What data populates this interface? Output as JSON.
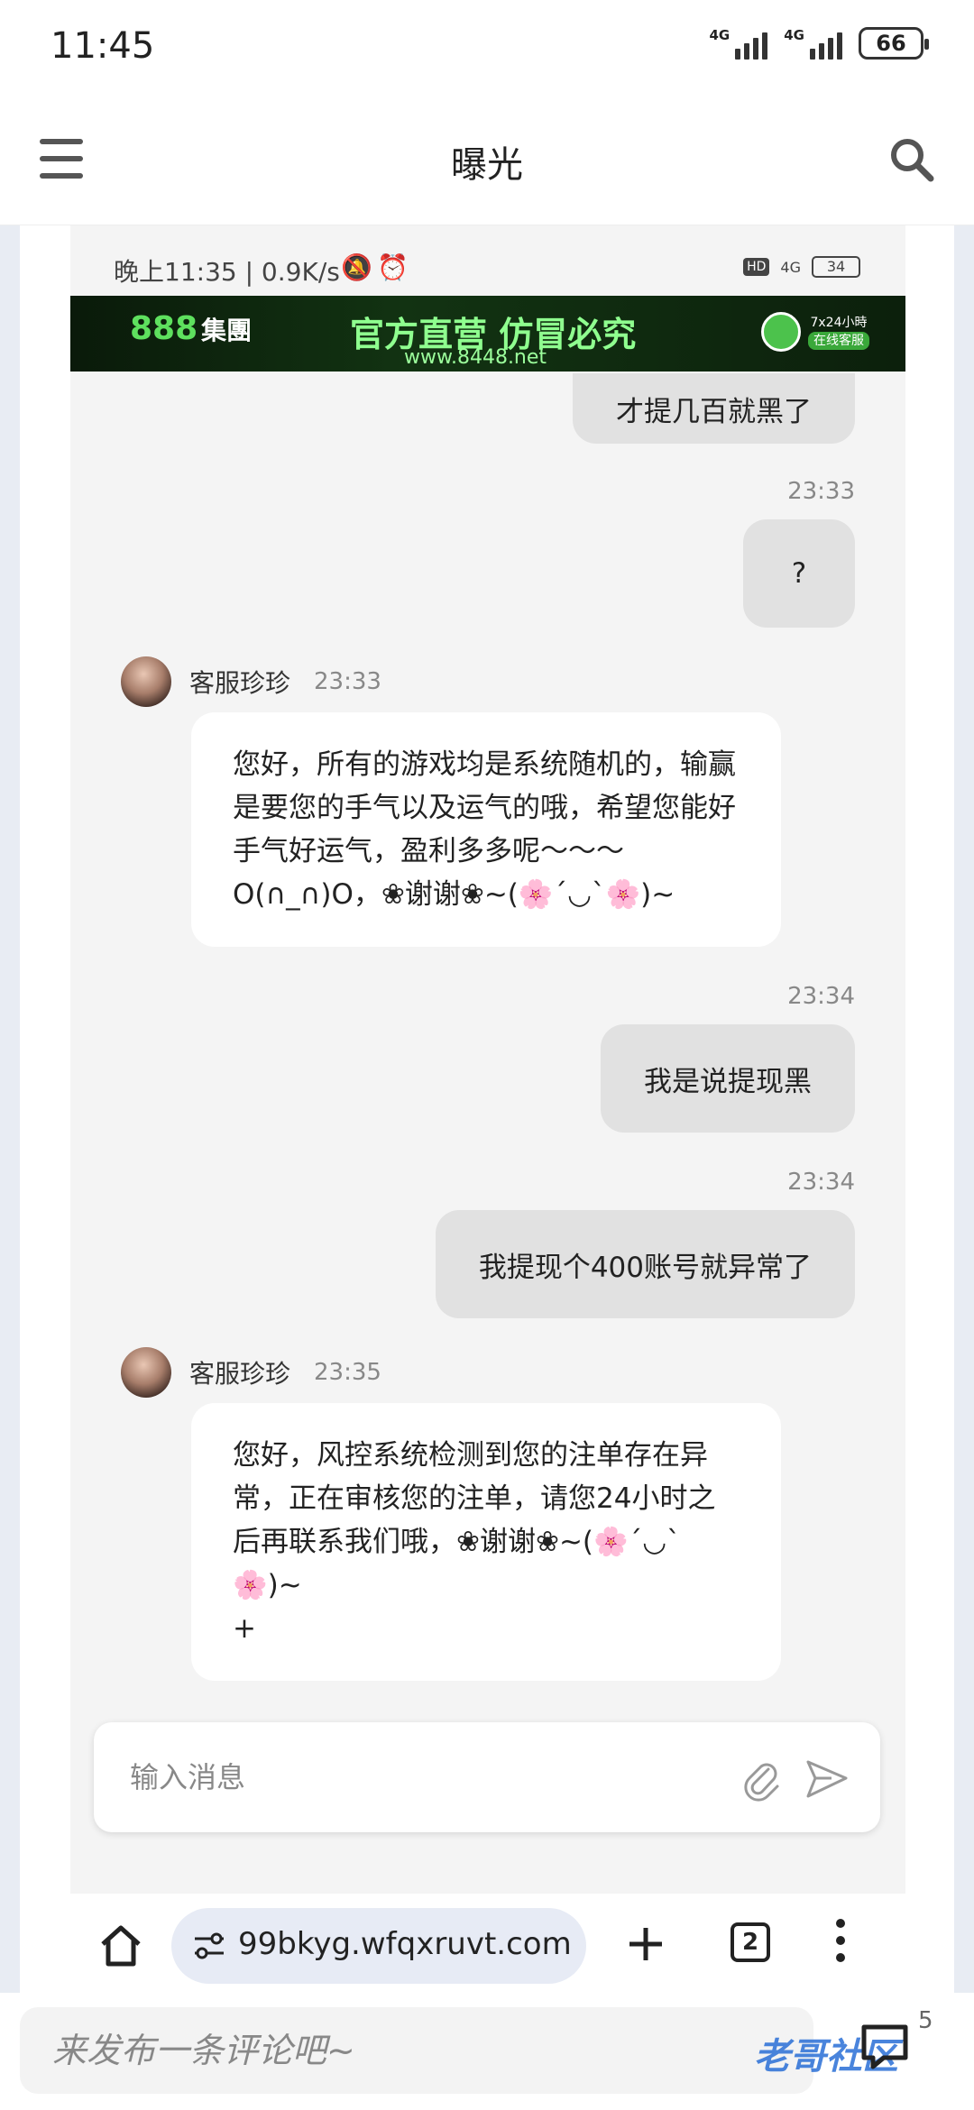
{
  "status_bar": {
    "time": "11:45",
    "signal1_label": "4G",
    "signal2_label": "4G",
    "battery": "66"
  },
  "app_bar": {
    "title": "曝光"
  },
  "inner_status": {
    "left": "晚上11:35 | 0.9K/s",
    "hd": "HD",
    "signal_label": "4G",
    "battery": "34"
  },
  "banner": {
    "logo_num": "888",
    "logo_text": "集團",
    "slogan": "官方直营 仿冒必究",
    "url": "www.8448.net",
    "cs_top": "7x24小時",
    "cs_bottom": "在线客服"
  },
  "messages": [
    {
      "side": "right",
      "text": "才提几百就黑了"
    },
    {
      "side": "right",
      "time": "23:33",
      "text": "?"
    },
    {
      "side": "left",
      "name": "客服珍珍",
      "time": "23:33",
      "text": "您好，所有的游戏均是系统随机的，输赢是要您的手气以及运气的哦，希望您能好手气好运气，盈利多多呢～～～O(∩_∩)O，❀谢谢❀~(🌸´◡`🌸)~"
    },
    {
      "side": "right",
      "time": "23:34",
      "text": "我是说提现黑"
    },
    {
      "side": "right",
      "time": "23:34",
      "text": "我提现个400账号就异常了"
    },
    {
      "side": "left",
      "name": "客服珍珍",
      "time": "23:35",
      "text": "您好，风控系统检测到您的注单存在异常，正在审核您的注单，请您24小时之后再联系我们哦，❀谢谢❀~(🌸´◡`🌸)~\n+"
    }
  ],
  "chat_input": {
    "placeholder": "输入消息"
  },
  "browser_bar": {
    "url": "99bkyg.wfqxruvt.com",
    "tab_count": "2"
  },
  "comment_bar": {
    "placeholder": "来发布一条评论吧~",
    "count": "5",
    "watermark": "老哥社区"
  }
}
